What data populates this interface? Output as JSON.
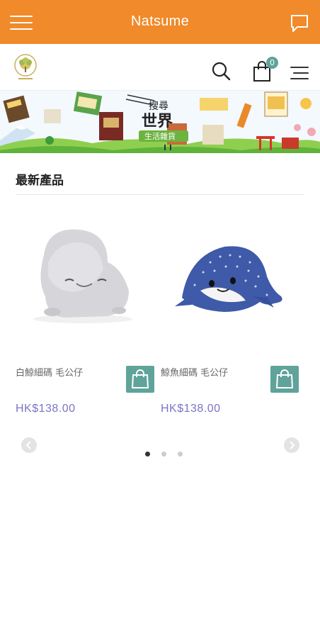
{
  "appbar": {
    "title": "Natsume",
    "menu_icon": "hamburger-icon",
    "chat_icon": "chat-bubble-icon",
    "color": "#f08a2a"
  },
  "header": {
    "logo": "natsume-logo",
    "search_icon": "search-icon",
    "cart_icon": "shopping-bag-icon",
    "cart_count": "0",
    "menu_icon": "menu-icon"
  },
  "banner": {
    "line1": "搜尋",
    "line2": "世界",
    "line3": "生活雜貨"
  },
  "section": {
    "title": "最新產品"
  },
  "products": [
    {
      "name": "白鯨細碼 毛公仔",
      "price": "HK$138.00"
    },
    {
      "name": "鯨魚細碼 毛公仔",
      "price": "HK$138.00"
    }
  ],
  "carousel": {
    "pages": 3,
    "active": 0,
    "prev_icon": "chevron-left-icon",
    "next_icon": "chevron-right-icon"
  },
  "colors": {
    "accent": "#f08a2a",
    "teal": "#5fa39a",
    "price": "#7b74c8"
  }
}
